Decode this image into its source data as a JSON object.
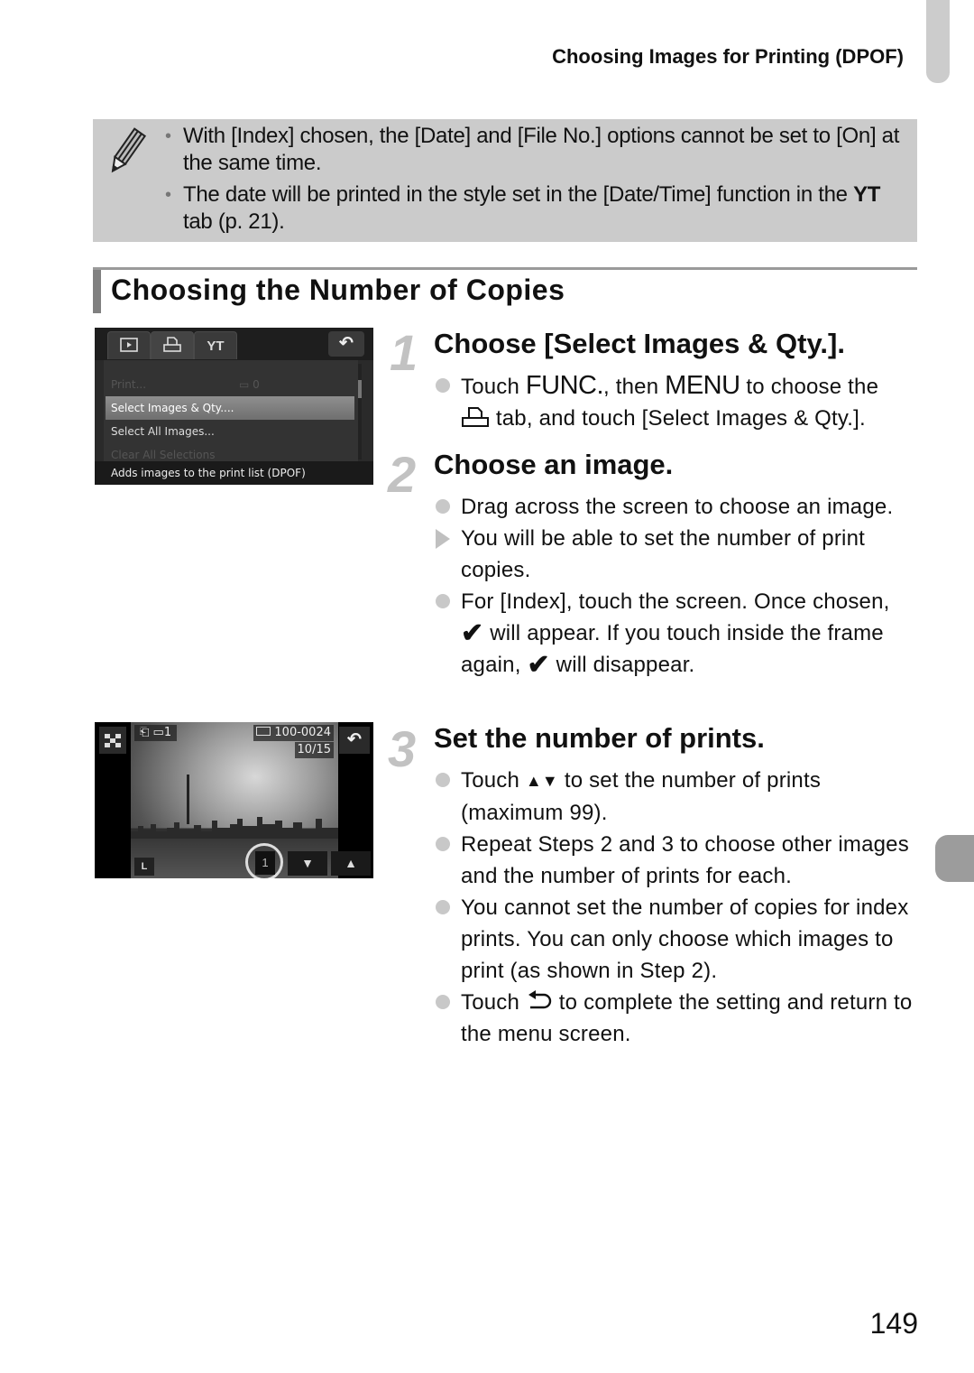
{
  "header": {
    "running_title": "Choosing Images for Printing (DPOF)"
  },
  "note": {
    "icon": "pencil-icon",
    "items": [
      "With [Index] chosen, the [Date] and [File No.] options cannot be set to [On] at the same time.",
      {
        "pre": "The date will be printed in the style set in the [Date/Time] function in the ",
        "icon": "ƒƮ",
        "post": " tab (p. 21)."
      }
    ],
    "item2_pre": "The date will be printed in the style set in the [Date/Time] function in the ",
    "item2_icon": "ΥΤ",
    "item2_post": " tab (p. 21)."
  },
  "section": {
    "title": "Choosing the Number of Copies"
  },
  "steps": [
    {
      "number": "1",
      "title": "Choose [Select Images & Qty.].",
      "b1_pre": "Touch ",
      "b1_func": "FUNC.",
      "b1_mid": ", then ",
      "b1_menu": "MENU",
      "b1_post": " to choose the",
      "b1_icon": "⎗",
      "b1_post2": " tab, and touch [Select Images & Qty.]."
    },
    {
      "number": "2",
      "title": "Choose an image.",
      "bullets": [
        "Drag across the screen to choose an image.",
        "You will be able to set the number of print copies."
      ],
      "b3_pre": "For [Index], touch the screen. Once chosen, ",
      "b3_mid": " will appear. If you touch inside the frame again, ",
      "b3_post": " will disappear.",
      "check": "✔"
    },
    {
      "number": "3",
      "title": "Set the number of prints.",
      "b1_pre": "Touch ",
      "b1_icon": "▲▼",
      "b1_post": " to set the number of prints (maximum 99).",
      "b2": "Repeat Steps 2 and 3 to choose other images and the number of prints for each.",
      "b3": "You cannot set the number of copies for index prints. You can only choose which images to print (as shown in Step 2).",
      "b4_pre": "Touch ",
      "b4_icon": "⮌",
      "b4_post": " to complete the setting and return to the menu screen."
    }
  ],
  "camera_menu": {
    "tabs": [
      {
        "icon": "playback-icon",
        "glyph": "▶"
      },
      {
        "icon": "print-icon",
        "glyph": "⎗"
      },
      {
        "icon": "settings-tools-icon",
        "glyph": "ΥΤ"
      }
    ],
    "back_glyph": "↶",
    "items": [
      {
        "label": "Print...",
        "count": "▭ 0",
        "state": "disabled"
      },
      {
        "label": "Select Images & Qty....",
        "state": "selected"
      },
      {
        "label": "Select All Images...",
        "state": "normal"
      },
      {
        "label": "Clear All Selections",
        "state": "disabled"
      }
    ],
    "hint": "Adds images to the print list (DPOF)"
  },
  "camera_playback": {
    "print_status": "⎗ ▭1",
    "file_number": "100-0024",
    "image_counter": "10/15",
    "image_size": "L",
    "quantity": "1",
    "down_glyph": "▼",
    "up_glyph": "▲",
    "back_glyph": "↶",
    "index_glyph": "▦"
  },
  "footer": {
    "page_number": "149"
  }
}
